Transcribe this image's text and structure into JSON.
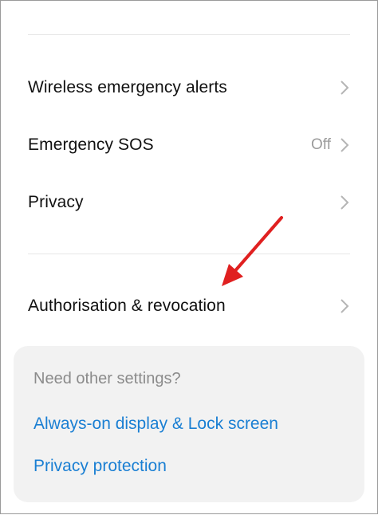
{
  "settings": {
    "items": [
      {
        "label": "Wireless emergency alerts",
        "value": "",
        "icon": "chevron-right-icon"
      },
      {
        "label": "Emergency SOS",
        "value": "Off",
        "icon": "chevron-right-icon"
      },
      {
        "label": "Privacy",
        "value": "",
        "icon": "chevron-right-icon"
      },
      {
        "label": "Authorisation & revocation",
        "value": "",
        "icon": "chevron-right-icon"
      }
    ]
  },
  "suggestions": {
    "title": "Need other settings?",
    "links": [
      "Always-on display & Lock screen",
      "Privacy protection"
    ]
  },
  "annotation": {
    "arrow_color": "#e02020",
    "icon": "red-arrow-icon"
  },
  "colors": {
    "link": "#1a7fd3",
    "panel_bg": "#f2f2f2",
    "secondary_text": "#9b9b9b"
  }
}
